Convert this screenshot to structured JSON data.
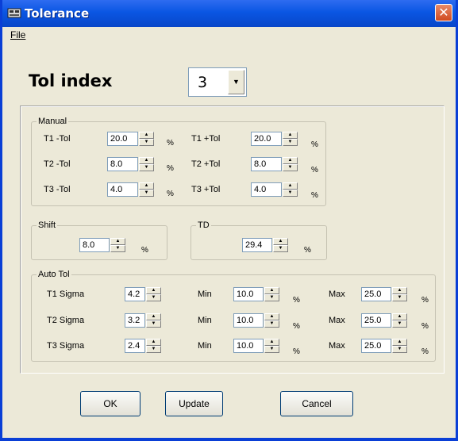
{
  "window": {
    "title": "Tolerance",
    "close_glyph": "✕"
  },
  "menu": {
    "file_label": "File"
  },
  "tol_index": {
    "label": "Tol index",
    "value": "3",
    "dropdown_glyph": "▼"
  },
  "manual": {
    "title": "Manual",
    "rows": [
      {
        "minus_label": "T1 -Tol",
        "minus_value": "20.0",
        "plus_label": "T1 +Tol",
        "plus_value": "20.0"
      },
      {
        "minus_label": "T2 -Tol",
        "minus_value": "8.0",
        "plus_label": "T2 +Tol",
        "plus_value": "8.0"
      },
      {
        "minus_label": "T3 -Tol",
        "minus_value": "4.0",
        "plus_label": "T3 +Tol",
        "plus_value": "4.0"
      }
    ]
  },
  "shift": {
    "title": "Shift",
    "value": "8.0"
  },
  "td": {
    "title": "TD",
    "value": "29.4"
  },
  "auto_tol": {
    "title": "Auto Tol",
    "min_label": "Min",
    "max_label": "Max",
    "rows": [
      {
        "sigma_label": "T1 Sigma",
        "sigma_value": "4.2",
        "min_value": "10.0",
        "max_value": "25.0"
      },
      {
        "sigma_label": "T2 Sigma",
        "sigma_value": "3.2",
        "min_value": "10.0",
        "max_value": "25.0"
      },
      {
        "sigma_label": "T3 Sigma",
        "sigma_value": "2.4",
        "min_value": "10.0",
        "max_value": "25.0"
      }
    ]
  },
  "units": {
    "percent": "%"
  },
  "spin": {
    "up_glyph": "▲",
    "down_glyph": "▼"
  },
  "buttons": {
    "ok": "OK",
    "update": "Update",
    "cancel": "Cancel"
  }
}
